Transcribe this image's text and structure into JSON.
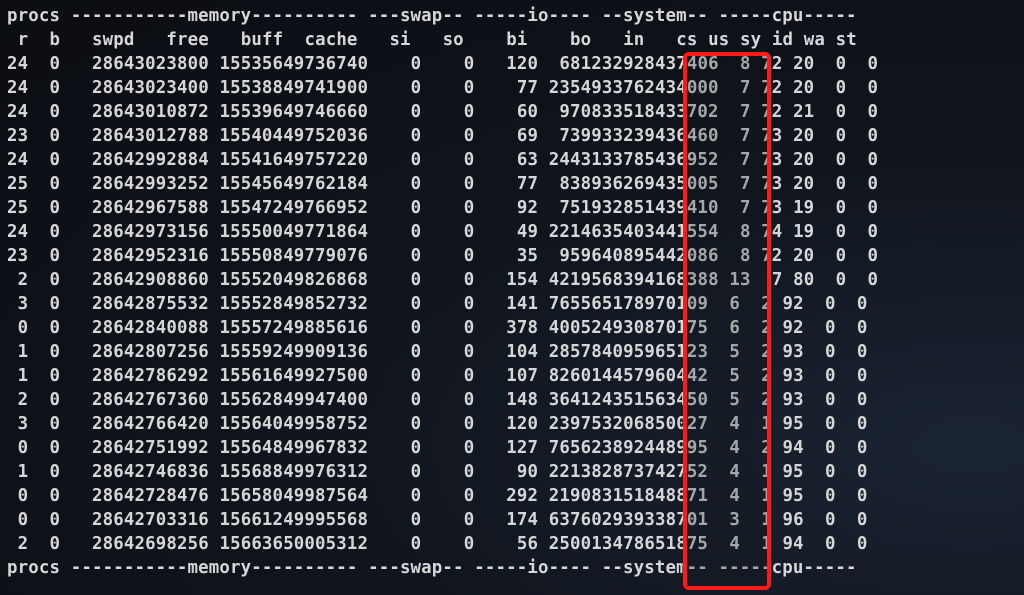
{
  "terminal": {
    "group_header": "procs -----------memory---------- ---swap-- -----io---- --system-- -----cpu-----",
    "columns": [
      "r",
      "b",
      "swpd",
      "free",
      "buff",
      "cache",
      "si",
      "so",
      "bi",
      "bo",
      "in",
      "cs",
      "us",
      "sy",
      "id",
      "wa",
      "st"
    ],
    "rows": [
      [
        24,
        0,
        2864,
        3023800,
        155356,
        49736740,
        0,
        0,
        120,
        6812,
        32928,
        437406,
        8,
        72,
        20,
        0,
        0
      ],
      [
        24,
        0,
        2864,
        3023400,
        155388,
        49741900,
        0,
        0,
        77,
        23549,
        33762,
        434000,
        7,
        72,
        20,
        0,
        0
      ],
      [
        24,
        0,
        2864,
        3010872,
        155396,
        49746660,
        0,
        0,
        60,
        9708,
        33518,
        433702,
        7,
        72,
        21,
        0,
        0
      ],
      [
        23,
        0,
        2864,
        3012788,
        155404,
        49752036,
        0,
        0,
        69,
        7399,
        33239,
        436460,
        7,
        73,
        20,
        0,
        0
      ],
      [
        24,
        0,
        2864,
        2992884,
        155416,
        49757220,
        0,
        0,
        63,
        24431,
        33785,
        436952,
        7,
        73,
        20,
        0,
        0
      ],
      [
        25,
        0,
        2864,
        2993252,
        155456,
        49762184,
        0,
        0,
        77,
        8389,
        36269,
        435005,
        7,
        73,
        20,
        0,
        0
      ],
      [
        25,
        0,
        2864,
        2967588,
        155472,
        49766952,
        0,
        0,
        92,
        7519,
        32851,
        439410,
        7,
        73,
        19,
        0,
        0
      ],
      [
        24,
        0,
        2864,
        2973156,
        155500,
        49771864,
        0,
        0,
        49,
        22146,
        35403,
        441554,
        8,
        74,
        19,
        0,
        0
      ],
      [
        23,
        0,
        2864,
        2952316,
        155508,
        49779076,
        0,
        0,
        35,
        9596,
        40895,
        442086,
        8,
        72,
        20,
        0,
        0
      ],
      [
        2,
        0,
        2864,
        2908860,
        155520,
        49826868,
        0,
        0,
        154,
        42195,
        68394,
        168388,
        13,
        7,
        80,
        0,
        0
      ],
      [
        3,
        0,
        2864,
        2875532,
        155528,
        49852732,
        0,
        0,
        141,
        76556,
        51789,
        70109,
        6,
        2,
        92,
        0,
        0
      ],
      [
        0,
        0,
        2864,
        2840088,
        155572,
        49885616,
        0,
        0,
        378,
        40052,
        49308,
        70175,
        6,
        2,
        92,
        0,
        0
      ],
      [
        1,
        0,
        2864,
        2807256,
        155592,
        49909136,
        0,
        0,
        104,
        28578,
        40959,
        65123,
        5,
        2,
        93,
        0,
        0
      ],
      [
        1,
        0,
        2864,
        2786292,
        155616,
        49927500,
        0,
        0,
        107,
        82601,
        44579,
        60442,
        5,
        2,
        93,
        0,
        0
      ],
      [
        2,
        0,
        2864,
        2767360,
        155628,
        49947400,
        0,
        0,
        148,
        36412,
        43515,
        63450,
        5,
        2,
        93,
        0,
        0
      ],
      [
        3,
        0,
        2864,
        2766420,
        155640,
        49958752,
        0,
        0,
        120,
        23975,
        32068,
        50027,
        4,
        1,
        95,
        0,
        0
      ],
      [
        0,
        0,
        2864,
        2751992,
        155648,
        49967832,
        0,
        0,
        127,
        76562,
        38924,
        48995,
        4,
        2,
        94,
        0,
        0
      ],
      [
        1,
        0,
        2864,
        2746836,
        155688,
        49976312,
        0,
        0,
        90,
        22138,
        28737,
        42752,
        4,
        1,
        95,
        0,
        0
      ],
      [
        0,
        0,
        2864,
        2728476,
        156580,
        49987564,
        0,
        0,
        292,
        21908,
        31518,
        48871,
        4,
        1,
        95,
        0,
        0
      ],
      [
        0,
        0,
        2864,
        2703316,
        156612,
        49995568,
        0,
        0,
        174,
        63760,
        29393,
        38701,
        3,
        1,
        96,
        0,
        0
      ],
      [
        2,
        0,
        2864,
        2698256,
        156636,
        50005312,
        0,
        0,
        56,
        25001,
        34786,
        51875,
        4,
        1,
        94,
        0,
        0
      ]
    ],
    "trailing_header": "procs -----------memory---------- ---swap-- -----io---- --system-- -----cpu-----"
  },
  "highlight": {
    "column": "cs",
    "color": "#ff1a1a"
  },
  "colors": {
    "text": "#d6d6d6",
    "background": "#0b0d12"
  }
}
